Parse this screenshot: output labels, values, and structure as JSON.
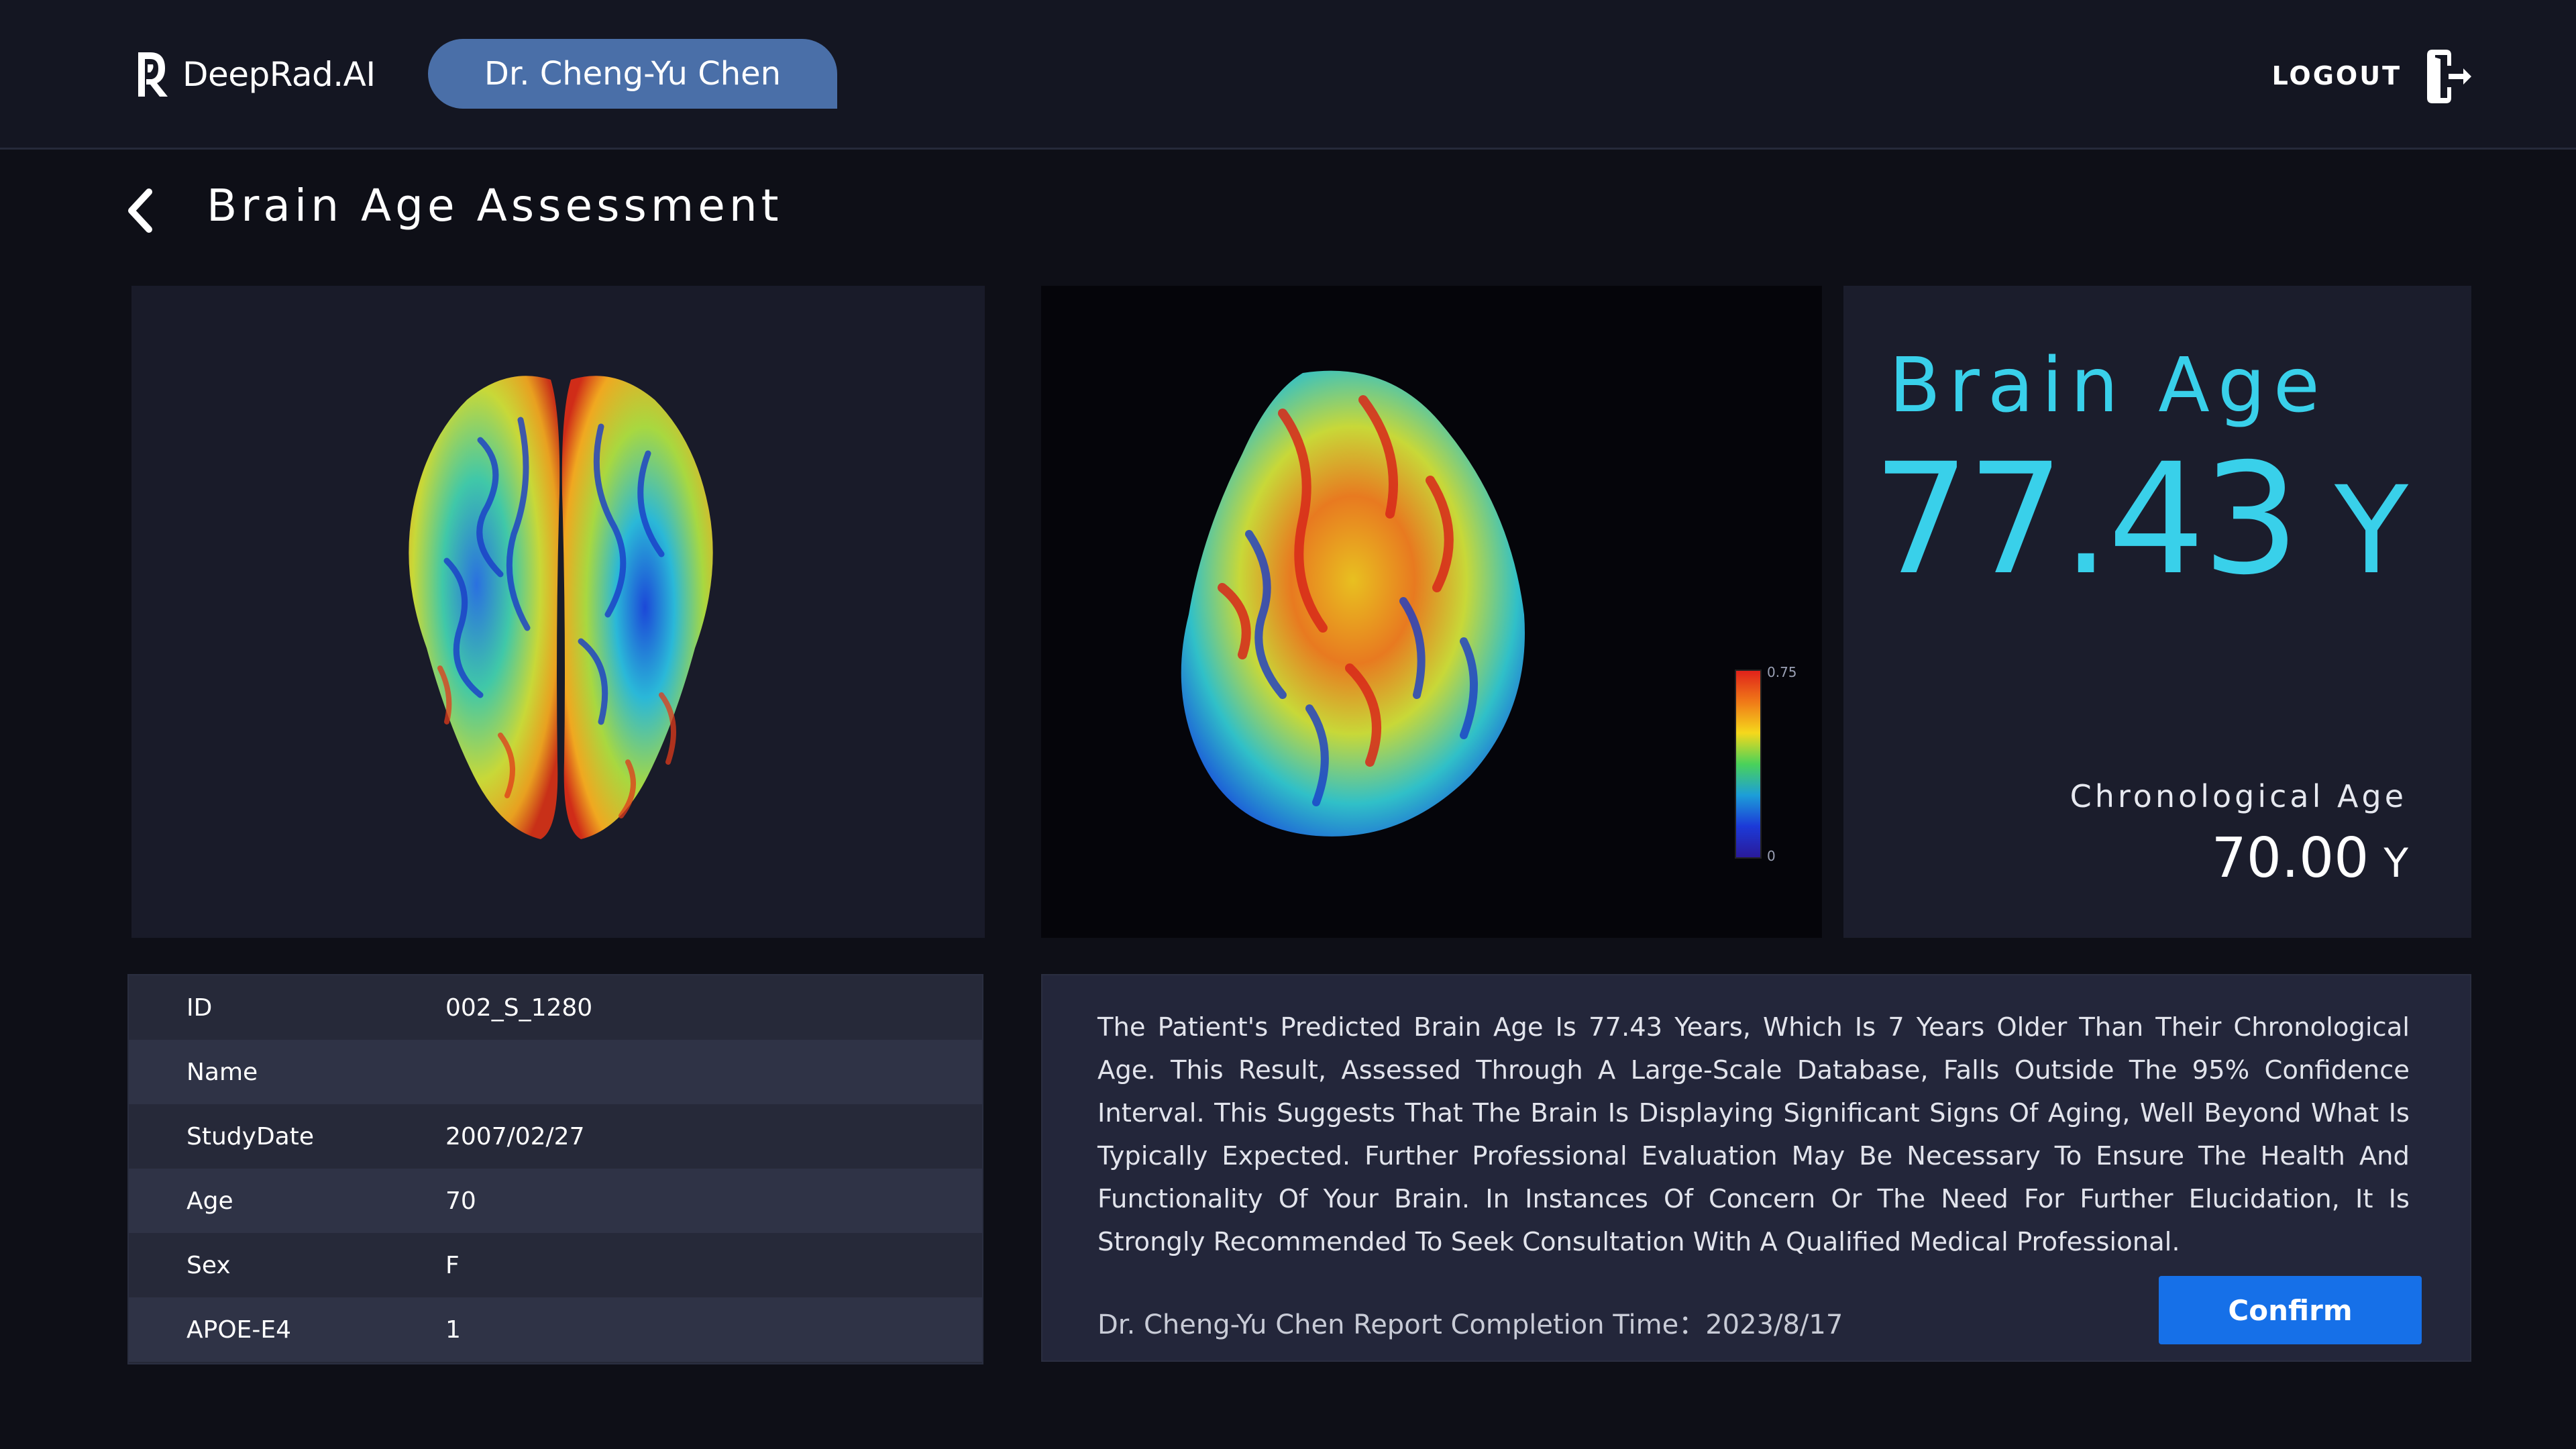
{
  "header": {
    "logo_text": "DeepRad.AI",
    "doctor_name": "Dr. Cheng-Yu Chen",
    "logout_label": "LOGOUT"
  },
  "page": {
    "title": "Brain Age Assessment"
  },
  "colorbar": {
    "max": "0.75",
    "min": "0"
  },
  "brain_age": {
    "label": "Brain Age",
    "value": "77.43",
    "unit": "Y",
    "chronological_label": "Chronological Age",
    "chronological_value": "70.00",
    "chronological_unit": "Y"
  },
  "patient_info": [
    {
      "key": "ID",
      "value": "002_S_1280"
    },
    {
      "key": "Name",
      "value": ""
    },
    {
      "key": "StudyDate",
      "value": "2007/02/27"
    },
    {
      "key": "Age",
      "value": "70"
    },
    {
      "key": "Sex",
      "value": "F"
    },
    {
      "key": "APOE-E4",
      "value": "1"
    }
  ],
  "report": {
    "text": "The Patient's Predicted Brain Age Is 77.43 Years, Which Is 7 Years Older Than Their Chronological Age. This Result, Assessed Through A Large-Scale Database, Falls Outside The 95% Confidence Interval. This Suggests That The Brain Is Displaying Significant Signs Of Aging, Well Beyond What Is Typically Expected. Further Professional Evaluation May Be Necessary To Ensure The Health And Functionality Of Your Brain. In Instances Of Concern Or The Need For Further Elucidation, It Is Strongly Recommended To Seek Consultation With A Qualified Medical Professional.",
    "footer": "Dr. Cheng-Yu Chen  Report Completion Time：2023/8/17",
    "confirm_label": "Confirm"
  },
  "colors": {
    "accent": "#39d0ea",
    "primary_button": "#1670e8",
    "doctor_pill": "#4a6fa8",
    "background": "#0e0f17"
  }
}
